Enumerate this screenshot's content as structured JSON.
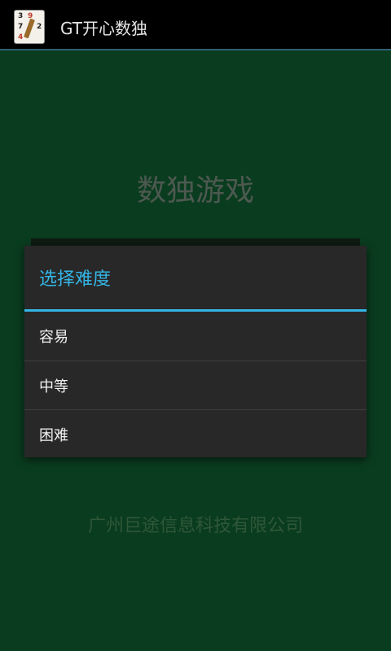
{
  "app": {
    "title": "GT开心数独",
    "icon_digits": [
      "3",
      "9",
      "7",
      "2",
      "4"
    ]
  },
  "main": {
    "title": "数独游戏",
    "company": "广州巨途信息科技有限公司"
  },
  "dialog": {
    "title": "选择难度",
    "options": [
      "容易",
      "中等",
      "困难"
    ]
  },
  "colors": {
    "background": "#0a3c1f",
    "accent": "#33b5e5",
    "dialog_bg": "#282828"
  }
}
